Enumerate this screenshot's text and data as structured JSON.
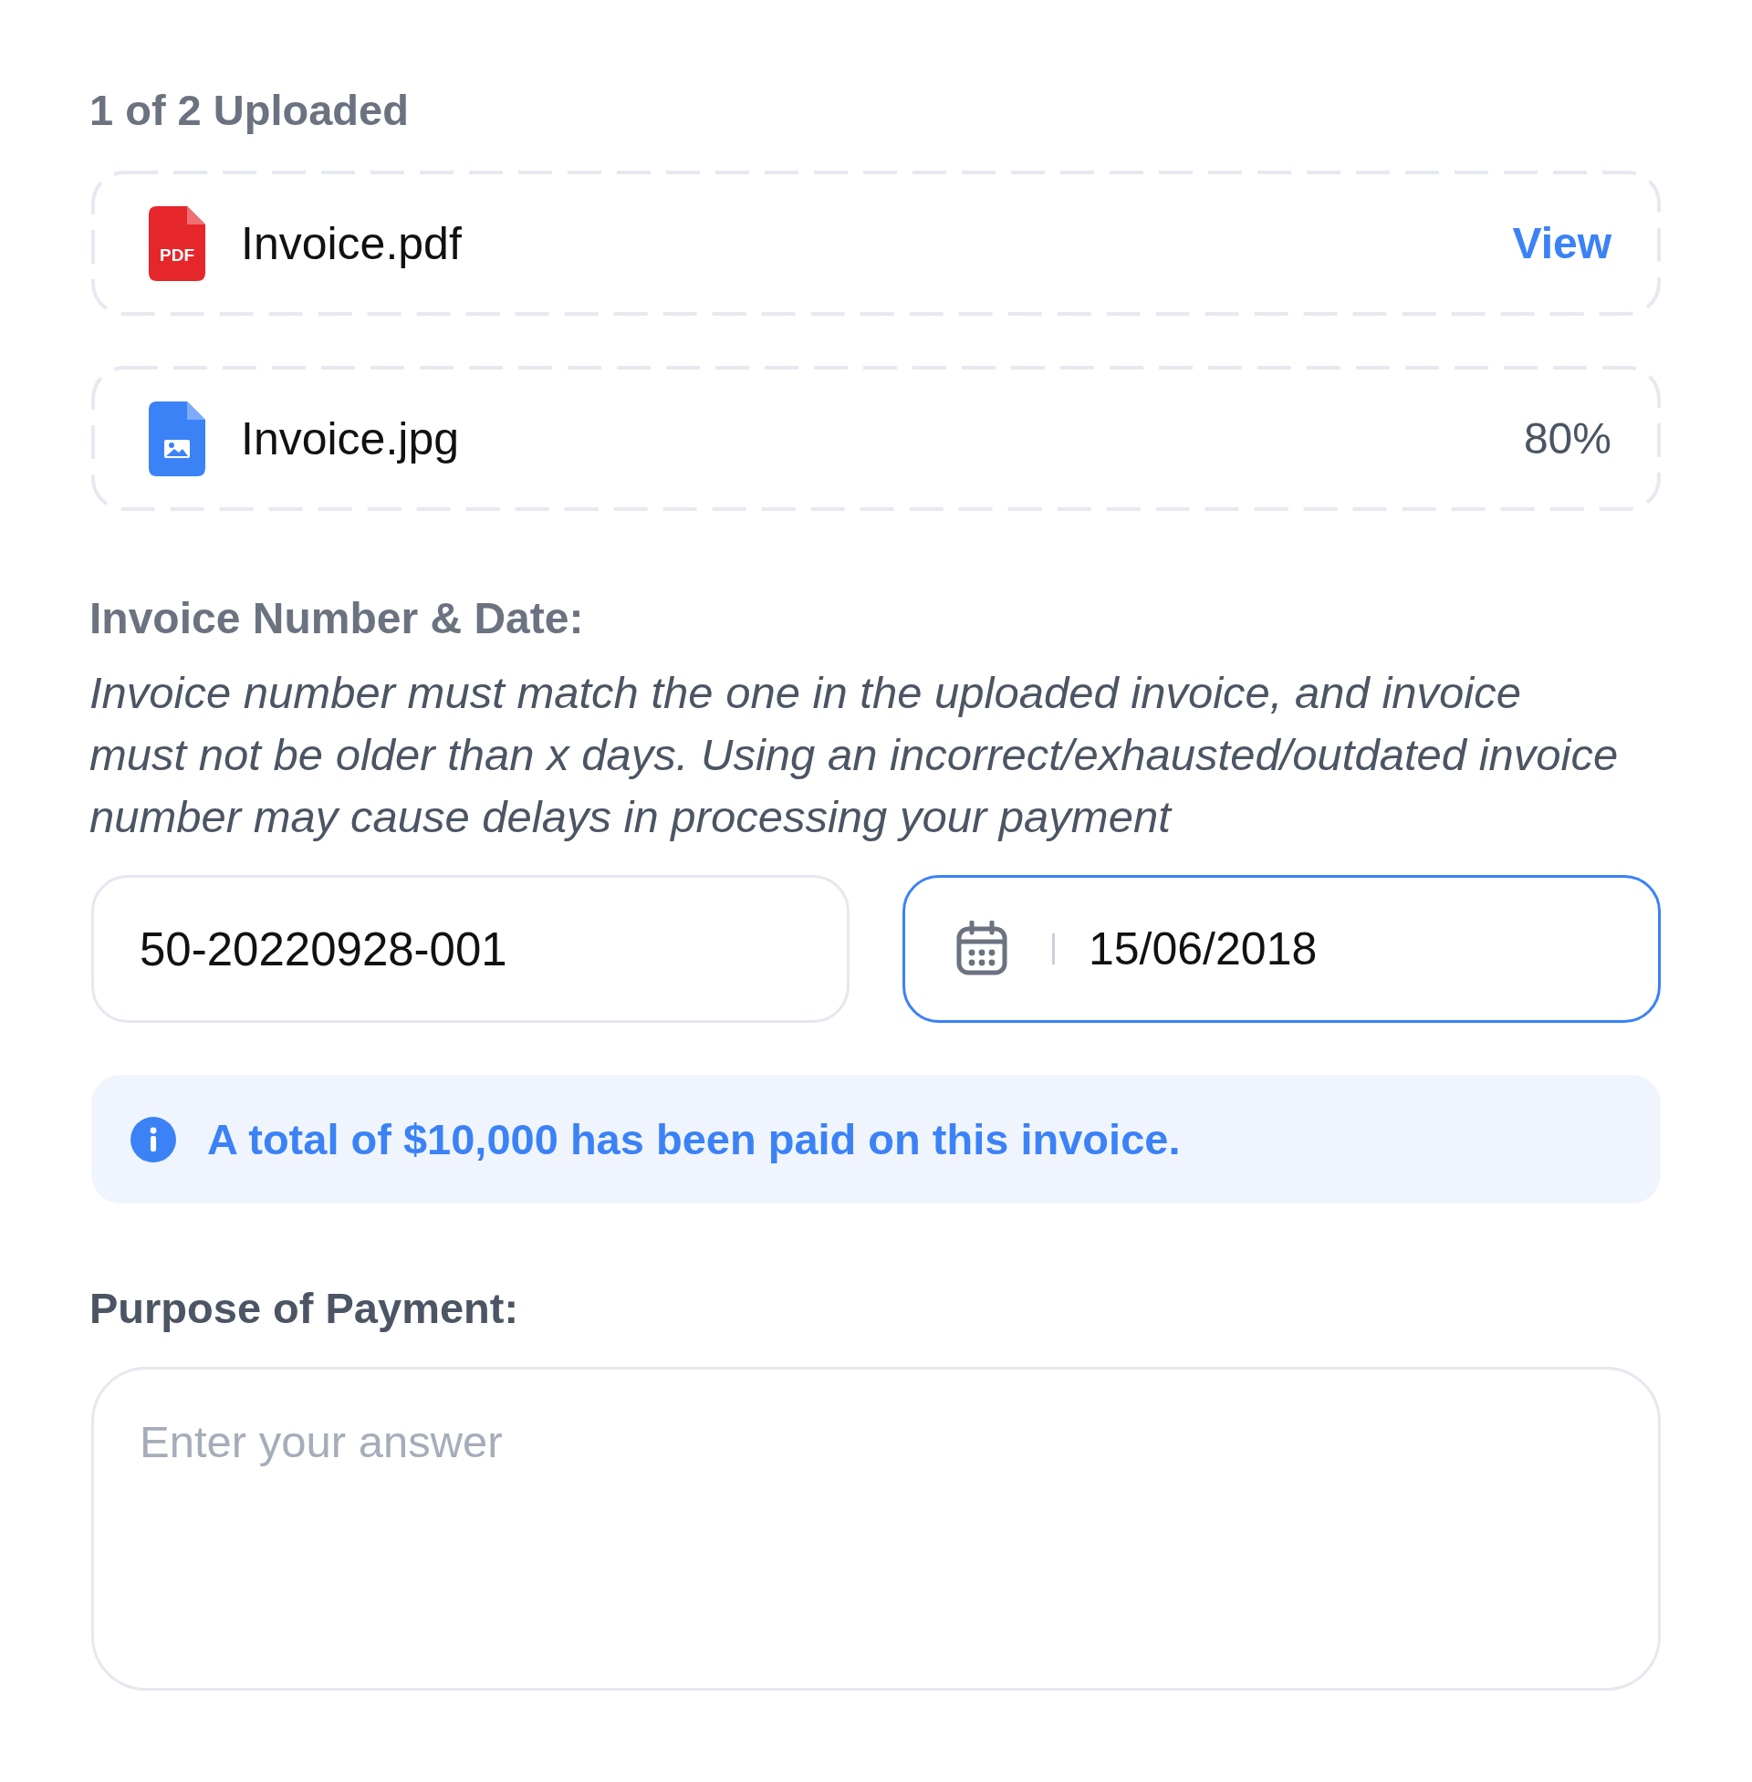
{
  "upload_status": "1 of 2 Uploaded",
  "files": [
    {
      "kind": "pdf",
      "icon_label": "PDF",
      "name": "Invoice.pdf",
      "action": "View"
    },
    {
      "kind": "image",
      "name": "Invoice.jpg",
      "progress": "80%"
    }
  ],
  "invoice_details": {
    "label": "Invoice Number & Date:",
    "hint_lines": [
      "Invoice number must match the one in the uploaded invoice, and invoice",
      "must not be older than x days. Using an incorrect/exhausted/outdated invoice",
      "number may cause delays in processing your payment"
    ],
    "number_field": {
      "value": "50-20220928-001",
      "focused": false
    },
    "date_field": {
      "value": "15/06/2018",
      "focused": true
    }
  },
  "notice": {
    "kind": "info",
    "text": "A total of $10,000 has been paid on this invoice."
  },
  "purpose": {
    "label": "Purpose of Payment:",
    "placeholder": "Enter your answer"
  }
}
